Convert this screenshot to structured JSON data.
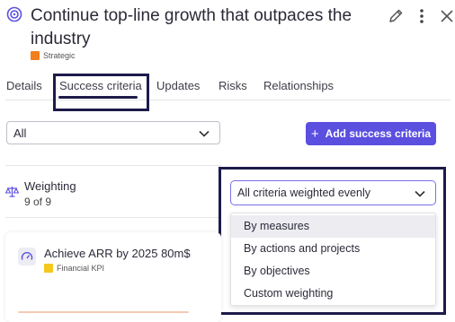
{
  "header": {
    "title": "Continue top-line growth that outpaces the industry",
    "category_tag": "Strategic",
    "colors": {
      "tag": "#f07f1e"
    },
    "icons": {
      "goal": "target-icon",
      "edit": "pencil-icon",
      "more": "more-vertical-icon",
      "close": "close-icon"
    }
  },
  "tabs": [
    {
      "label": "Details"
    },
    {
      "label": "Success criteria",
      "active": true
    },
    {
      "label": "Updates"
    },
    {
      "label": "Risks"
    },
    {
      "label": "Relationships"
    }
  ],
  "toolbar": {
    "filter_value": "All",
    "add_button_label": "Add success criteria",
    "colors": {
      "add_button": "#5b4fe0"
    }
  },
  "weighting": {
    "label": "Weighting",
    "count": "9 of 9",
    "selected": "All criteria weighted evenly",
    "options": [
      "By measures",
      "By actions and projects",
      "By objectives",
      "Custom weighting"
    ]
  },
  "card": {
    "title": "Achieve ARR by 2025 80m$",
    "tag": "Financial KPI",
    "colors": {
      "tag": "#f4c81c"
    }
  }
}
